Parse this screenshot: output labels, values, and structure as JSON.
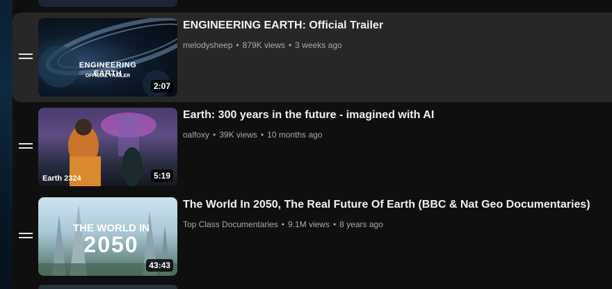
{
  "videos": [
    {
      "title": "ENGINEERING EARTH: Official Trailer",
      "channel": "melodysheep",
      "views": "879K views",
      "age": "3 weeks ago",
      "duration": "2:07",
      "thumb_text_1": "ENGINEERING EARTH",
      "thumb_text_2": "OFFICIAL TRAILER"
    },
    {
      "title": "Earth: 300 years in the future - imagined with AI",
      "channel": "oalfoxy",
      "views": "39K views",
      "age": "10 months ago",
      "duration": "5:19",
      "thumb_text_1": "Earth 2324"
    },
    {
      "title": "The World In 2050, The Real Future Of Earth (BBC & Nat Geo Documentaries)",
      "channel": "Top Class Documentaries",
      "views": "9.1M views",
      "age": "8 years ago",
      "duration": "43:43",
      "thumb_text_1": "THE WORLD IN",
      "thumb_text_2": "2050"
    }
  ],
  "separator": "•"
}
